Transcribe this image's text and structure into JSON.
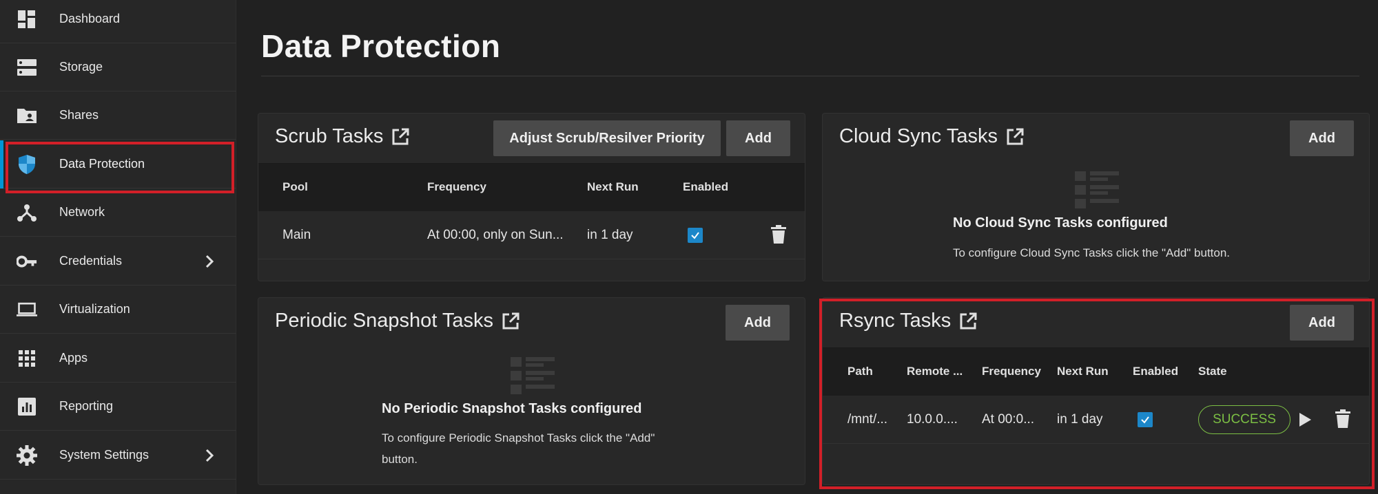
{
  "sidebar": {
    "items": [
      {
        "label": "Dashboard",
        "icon": "dashboard-icon"
      },
      {
        "label": "Storage",
        "icon": "storage-icon"
      },
      {
        "label": "Shares",
        "icon": "shares-folder-icon"
      },
      {
        "label": "Data Protection",
        "icon": "shield-icon",
        "active": true
      },
      {
        "label": "Network",
        "icon": "network-icon"
      },
      {
        "label": "Credentials",
        "icon": "key-icon",
        "has_submenu": true
      },
      {
        "label": "Virtualization",
        "icon": "laptop-icon"
      },
      {
        "label": "Apps",
        "icon": "apps-grid-icon"
      },
      {
        "label": "Reporting",
        "icon": "reporting-chart-icon"
      },
      {
        "label": "System Settings",
        "icon": "gear-icon",
        "has_submenu": true
      }
    ]
  },
  "page": {
    "title": "Data Protection"
  },
  "scrub": {
    "title": "Scrub Tasks",
    "priority_button": "Adjust Scrub/Resilver Priority",
    "add_button": "Add",
    "columns": [
      "Pool",
      "Frequency",
      "Next Run",
      "Enabled"
    ],
    "rows": [
      {
        "pool": "Main",
        "frequency": "At 00:00, only on Sun...",
        "next_run": "in 1 day",
        "enabled": true
      }
    ]
  },
  "cloud_sync": {
    "title": "Cloud Sync Tasks",
    "add_button": "Add",
    "empty_title": "No Cloud Sync Tasks configured",
    "empty_message": "To configure Cloud Sync Tasks click the \"Add\" button."
  },
  "snapshot": {
    "title": "Periodic Snapshot Tasks",
    "add_button": "Add",
    "empty_title": "No Periodic Snapshot Tasks configured",
    "empty_message": "To configure Periodic Snapshot Tasks click the \"Add\" button."
  },
  "rsync": {
    "title": "Rsync Tasks",
    "add_button": "Add",
    "columns": [
      "Path",
      "Remote ...",
      "Frequency",
      "Next Run",
      "Enabled",
      "State"
    ],
    "rows": [
      {
        "path": "/mnt/...",
        "remote": "10.0.0....",
        "frequency": "At 00:0...",
        "next_run": "in 1 day",
        "enabled": true,
        "state": "SUCCESS"
      }
    ]
  },
  "colors": {
    "accent": "#0095d5",
    "highlight": "#d21f28",
    "success": "#7cbf44",
    "checkbox": "#1c87c9"
  }
}
